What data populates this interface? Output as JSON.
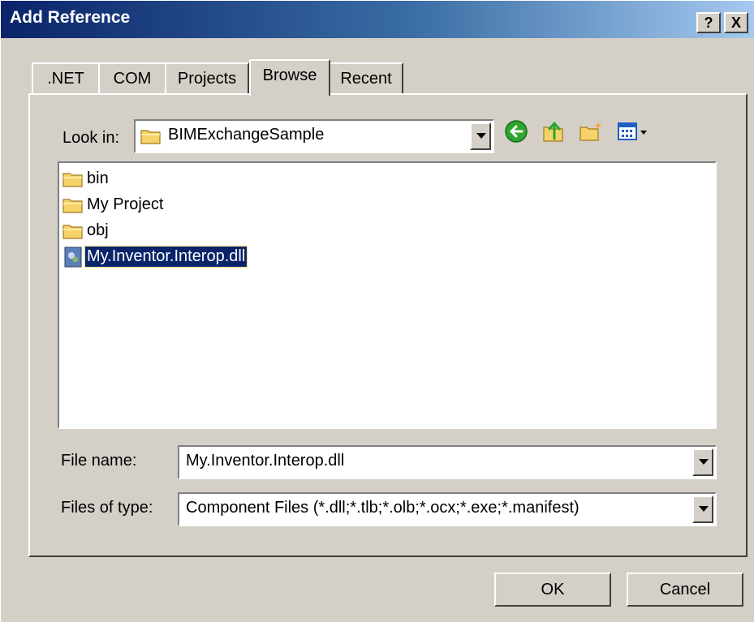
{
  "window": {
    "title": "Add Reference",
    "help_button": "?",
    "close_button": "X"
  },
  "tabs": [
    {
      "label": ".NET"
    },
    {
      "label": "COM"
    },
    {
      "label": "Projects"
    },
    {
      "label": "Browse",
      "active": true
    },
    {
      "label": "Recent"
    }
  ],
  "look_in": {
    "label": "Look in:",
    "value": "BIMExchangeSample"
  },
  "toolbar": {
    "icons": [
      "back-icon",
      "up-folder-icon",
      "new-folder-icon",
      "views-menu-icon"
    ]
  },
  "files": [
    {
      "name": "bin",
      "type": "folder"
    },
    {
      "name": "My Project",
      "type": "folder"
    },
    {
      "name": "obj",
      "type": "folder"
    },
    {
      "name": "My.Inventor.Interop.dll",
      "type": "dll",
      "selected": true
    }
  ],
  "file_name": {
    "label": "File name:",
    "value": "My.Inventor.Interop.dll"
  },
  "files_of_type": {
    "label": "Files of type:",
    "value": "Component Files (*.dll;*.tlb;*.olb;*.ocx;*.exe;*.manifest)"
  },
  "buttons": {
    "ok": "OK",
    "cancel": "Cancel"
  },
  "colors": {
    "title_bar": "#0a246a",
    "selection": "#0a246a",
    "face": "#d4d0c8"
  }
}
